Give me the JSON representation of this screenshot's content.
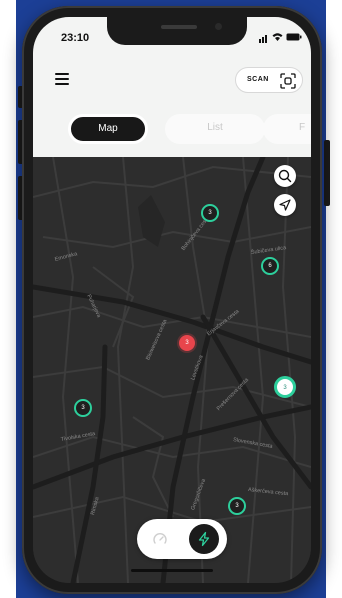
{
  "status_bar": {
    "time": "23:10"
  },
  "header": {
    "scan_label": "SCAN"
  },
  "tabs": [
    {
      "label": "Map",
      "active": true
    },
    {
      "label": "List",
      "active": false
    },
    {
      "label": "F",
      "active": false
    }
  ],
  "map": {
    "clusters": [
      {
        "label": "3"
      },
      {
        "label": "6"
      },
      {
        "label": "3"
      },
      {
        "label": "3"
      },
      {
        "label": "3"
      }
    ],
    "selected_pin": {
      "label": "3"
    },
    "streets": [
      "Bohinjčeva cesta",
      "Šubičeva ulica",
      "Erjavčeva cesta",
      "Bleiweisova cesta",
      "Prešernova cesta",
      "Levstikova",
      "Slovenska cesta",
      "Aškerčeva cesta",
      "Gregorčičeva",
      "Tivolska cesta",
      "Puharjeva",
      "Rimska",
      "Emonska"
    ]
  },
  "colors": {
    "accent_teal": "#2dcf9c",
    "alert_red": "#e8454c",
    "map_bg": "#2d2d2d"
  },
  "icons": {
    "menu": "hamburger-icon",
    "scan": "qr-scan-icon",
    "search": "search-icon",
    "locate": "navigation-arrow-icon",
    "left_toggle": "gauge-icon",
    "right_toggle": "lightning-bolt-icon"
  }
}
